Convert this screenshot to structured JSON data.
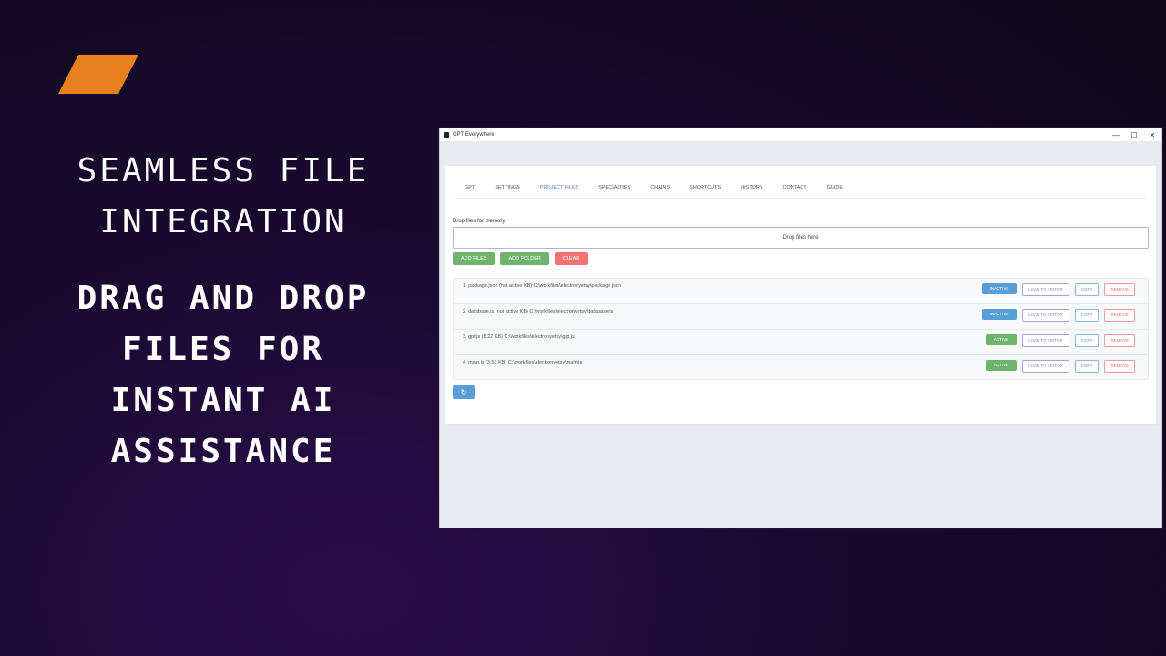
{
  "hero": {
    "headline_lines": [
      "SEAMLESS FILE",
      "INTEGRATION"
    ],
    "subheadline_lines": [
      "DRAG AND DROP",
      "FILES FOR",
      "INSTANT AI",
      "ASSISTANCE"
    ],
    "accent_color": "#e8801f"
  },
  "window": {
    "title": "GPT Everywhere",
    "controls": {
      "minimize": "—",
      "maximize": "☐",
      "close": "✕"
    }
  },
  "tabs": [
    {
      "label": "GPT"
    },
    {
      "label": "SETTINGS"
    },
    {
      "label": "PROJECT FILES",
      "active": true
    },
    {
      "label": "SPECIALTIES"
    },
    {
      "label": "CHAINS"
    },
    {
      "label": "SHORTCUTS"
    },
    {
      "label": "HISTORY"
    },
    {
      "label": "CONTACT"
    },
    {
      "label": "GUIDE"
    }
  ],
  "project_files": {
    "drop_label": "Drop files for memory:",
    "drop_zone_text": "Drop files here",
    "buttons": {
      "add_files": "ADD FILES",
      "add_folder": "ADD FOLDER",
      "clear": "CLEAR"
    },
    "files": [
      {
        "text": "1. package.json (not active KB) C:\\workfiles\\electronyetsy\\package.json",
        "status": "INACTIVE"
      },
      {
        "text": "2. database.js (not active KB) C:\\workfiles\\electronyetsy\\database.js",
        "status": "INACTIVE"
      },
      {
        "text": "3. gpt.js (8.22 KB) C:\\workfiles\\electronyetsy\\gpt.js",
        "status": "ACTIVE"
      },
      {
        "text": "4. main.js (3.51 KB) C:\\workfiles\\electronyetsy\\main.js",
        "status": "ACTIVE"
      }
    ],
    "row_actions": {
      "load": "LOAD TO EDITOR",
      "copy": "COPY",
      "remove": "REMOVE"
    },
    "refresh_icon": "↻"
  }
}
